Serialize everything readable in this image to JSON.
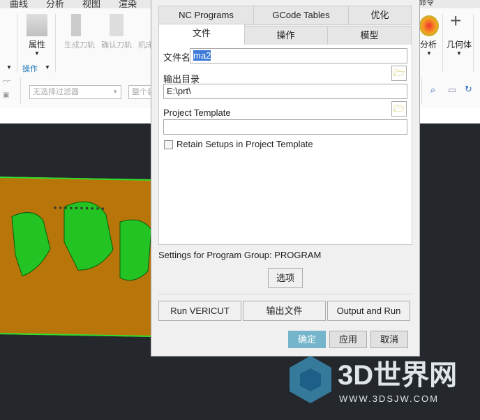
{
  "menubar": {
    "items": [
      "曲线",
      "分析",
      "视图",
      "渲染"
    ],
    "right_partial": "命令"
  },
  "ribbon": {
    "properties_label": "属性",
    "operations_group_label": "操作",
    "generate_toolpath": "生成刀轨",
    "verify_toolpath": "确认刀轨",
    "machine_partial": "机床",
    "analysis_label": "分析",
    "geometry_label": "几何体"
  },
  "toolbar": {
    "filter_placeholder": "无选择过滤器",
    "scope_partial": "整个装"
  },
  "dialog": {
    "tabs_row1": [
      "NC Programs",
      "GCode Tables",
      "优化"
    ],
    "tabs_row2": [
      "文件",
      "操作",
      "模型"
    ],
    "active_tab": "文件",
    "filename_label": "文件名",
    "filename_value": "ma2",
    "output_dir_label": "输出目录",
    "output_dir_value": "E:\\prt\\",
    "project_template_label": "Project Template",
    "project_template_value": "",
    "retain_setups_label": "Retain Setups in Project Template",
    "retain_setups_checked": false,
    "settings_text": "Settings for Program Group: PROGRAM",
    "options_button": "选项",
    "run_vericut_button": "Run VERICUT",
    "output_file_button": "输出文件",
    "output_and_run_button": "Output and Run",
    "ok_button": "确定",
    "apply_button": "应用",
    "cancel_button": "取消",
    "colors": {
      "ok_button": "#74b5cb",
      "selection": "#3b7ad8"
    }
  },
  "watermark": {
    "brand": "3D世界网",
    "url": "WWW.3DSJW.COM"
  }
}
